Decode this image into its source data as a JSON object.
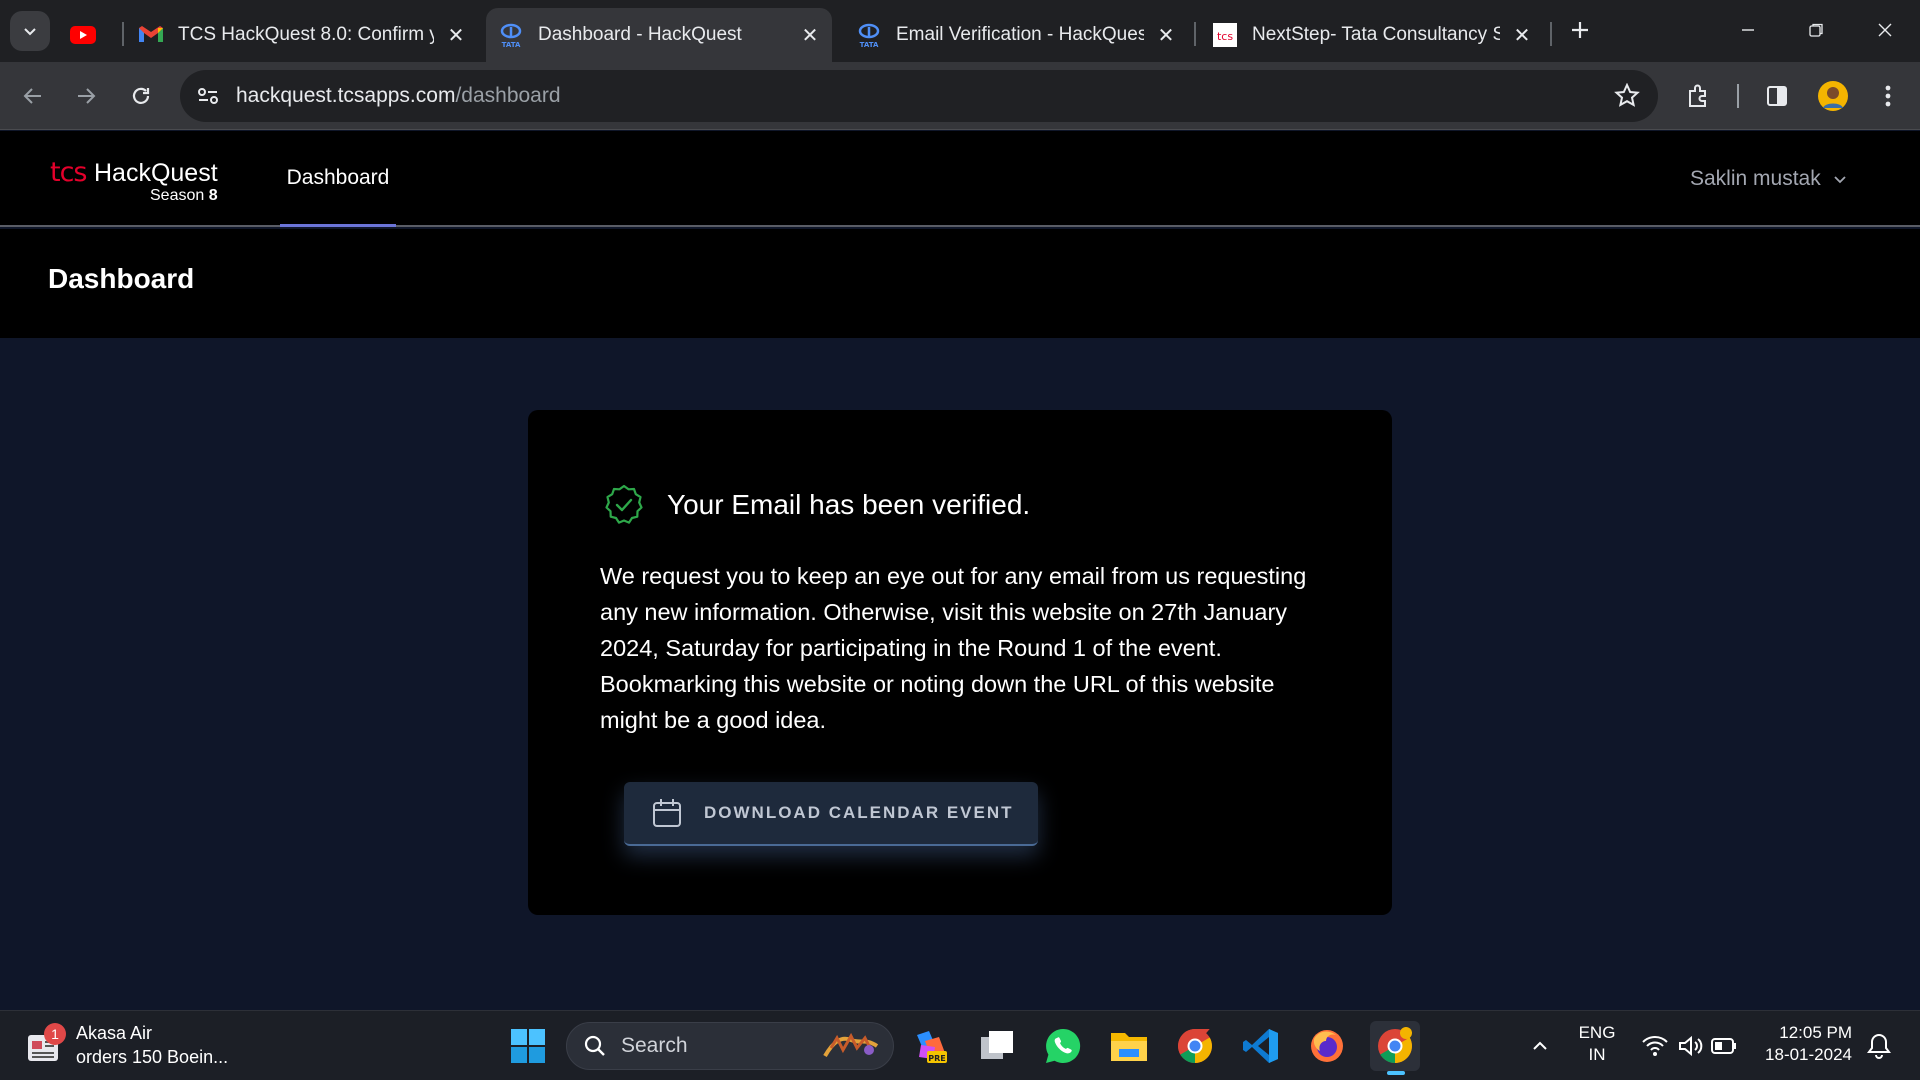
{
  "browser": {
    "tabs": [
      {
        "title": "TCS HackQuest 8.0: Confirm yo",
        "favicon": "gmail-icon",
        "active": false
      },
      {
        "title": "Dashboard - HackQuest",
        "favicon": "tata-icon",
        "active": true
      },
      {
        "title": "Email Verification - HackQuest",
        "favicon": "tata-icon",
        "active": false
      },
      {
        "title": "NextStep- Tata Consultancy Ser",
        "favicon": "tcs-icon",
        "active": false
      }
    ],
    "url_host": "hackquest.tcsapps.com",
    "url_path": "/dashboard"
  },
  "app": {
    "logo_tcs": "tcs",
    "logo_name": "HackQuest",
    "logo_season": "Season",
    "logo_season_num": "8",
    "nav_dashboard": "Dashboard",
    "user_name": "Saklin mustak",
    "page_title": "Dashboard"
  },
  "card": {
    "heading": "Your Email has been verified.",
    "body": "We request you to keep an eye out for any email from us requesting any new information. Otherwise, visit this website on 27th January 2024, Saturday for participating in the Round 1 of the event. Bookmarking this website or noting down the URL of this website might be a good idea.",
    "button_label": "DOWNLOAD CALENDAR EVENT"
  },
  "taskbar": {
    "news_badge": "1",
    "news_line1": "Akasa Air",
    "news_line2": "orders 150 Boein...",
    "search_label": "Search",
    "lang_line1": "ENG",
    "lang_line2": "IN",
    "time": "12:05 PM",
    "date": "18-01-2024"
  }
}
